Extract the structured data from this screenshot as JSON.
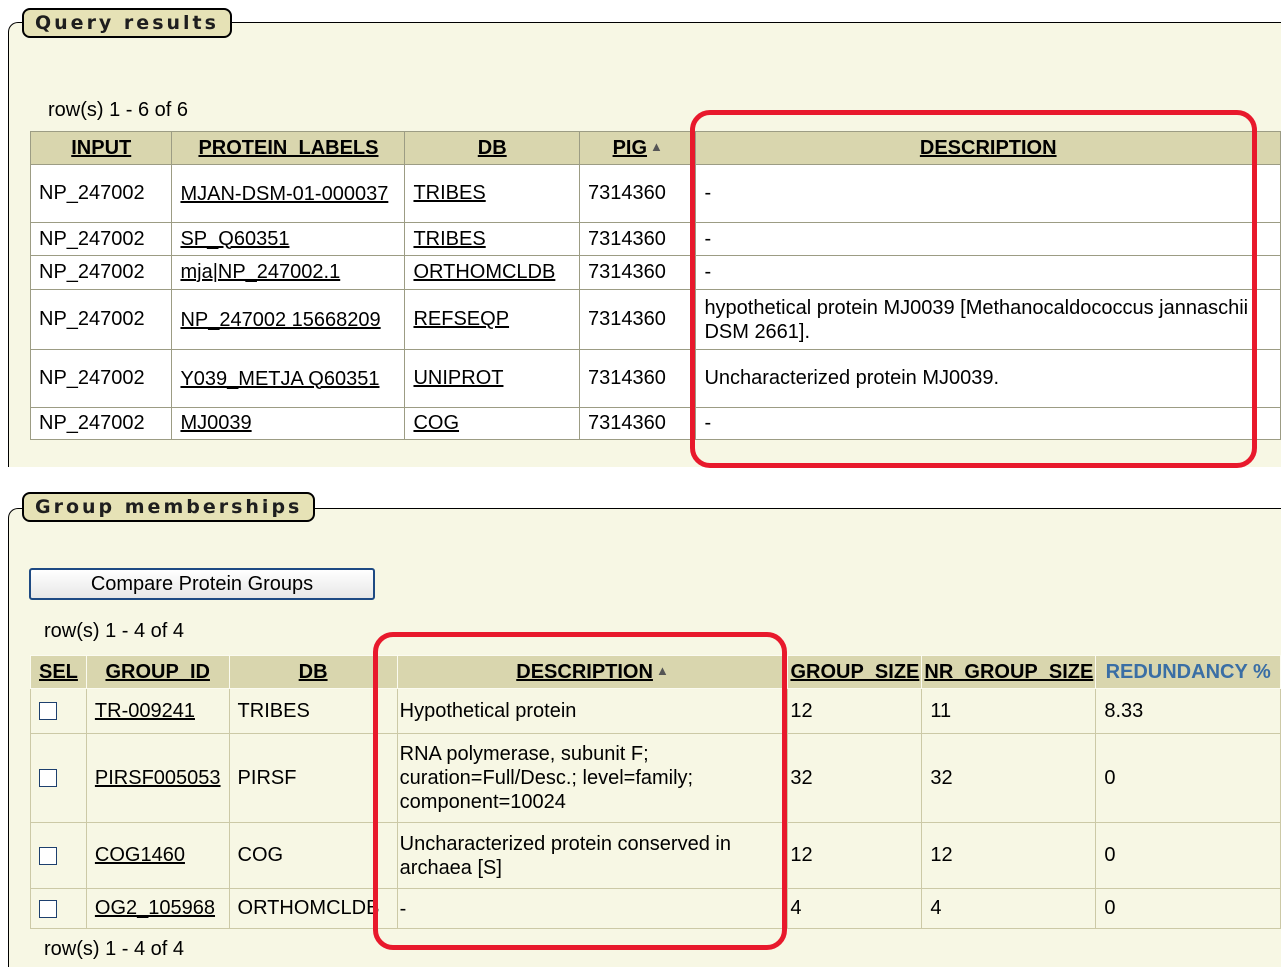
{
  "query_results": {
    "legend": "Query results",
    "row_count": "row(s) 1 - 6 of 6",
    "columns": [
      "INPUT",
      "PROTEIN_LABELS",
      "DB",
      "PIG",
      "DESCRIPTION"
    ],
    "rows": [
      {
        "input": "NP_247002",
        "protein_label": "MJAN-DSM-01-000037",
        "db": "TRIBES",
        "pig": "7314360",
        "description": "-"
      },
      {
        "input": "NP_247002",
        "protein_label": "SP_Q60351",
        "db": "TRIBES",
        "pig": "7314360",
        "description": "-"
      },
      {
        "input": "NP_247002",
        "protein_label": "mja|NP_247002.1",
        "db": "ORTHOMCLDB",
        "pig": "7314360",
        "description": "-"
      },
      {
        "input": "NP_247002",
        "protein_label": "NP_247002 15668209",
        "db": "REFSEQP",
        "pig": "7314360",
        "description": "hypothetical protein MJ0039 [Methanocaldococcus jannaschii DSM 2661]."
      },
      {
        "input": "NP_247002",
        "protein_label": "Y039_METJA Q60351",
        "db": "UNIPROT",
        "pig": "7314360",
        "description": "Uncharacterized protein MJ0039."
      },
      {
        "input": "NP_247002",
        "protein_label": "MJ0039",
        "db": "COG",
        "pig": "7314360",
        "description": "-"
      }
    ]
  },
  "group_memberships": {
    "legend": "Group memberships",
    "compare_button": "Compare Protein Groups",
    "row_count_top": "row(s) 1 - 4 of 4",
    "row_count_bottom": "row(s) 1 - 4 of 4",
    "columns": [
      "SEL",
      "GROUP_ID",
      "DB",
      "DESCRIPTION",
      "GROUP_SIZE",
      "NR_GROUP_SIZE",
      "REDUNDANCY %"
    ],
    "rows": [
      {
        "group_id": "TR-009241",
        "db": "TRIBES",
        "description": "Hypothetical protein",
        "group_size": "12",
        "nr_group_size": "11",
        "redundancy": "8.33"
      },
      {
        "group_id": "PIRSF005053",
        "db": "PIRSF",
        "description": "RNA polymerase, subunit F; curation=Full/Desc.; level=family; component=10024",
        "group_size": "32",
        "nr_group_size": "32",
        "redundancy": "0"
      },
      {
        "group_id": "COG1460",
        "db": "COG",
        "description": "Uncharacterized protein conserved in archaea [S]",
        "group_size": "12",
        "nr_group_size": "12",
        "redundancy": "0"
      },
      {
        "group_id": "OG2_105968",
        "db": "ORTHOMCLDB",
        "description": "-",
        "group_size": "4",
        "nr_group_size": "4",
        "redundancy": "0"
      }
    ]
  },
  "sort_icon": "sort-ascending-triangle-icon",
  "colors": {
    "panel_background": "#f7f7e4",
    "header_background": "#d9d6ae",
    "legend_background": "#e6e2b6",
    "highlight_red": "#e8192c",
    "redundancy_header": "#3a6ea5"
  }
}
